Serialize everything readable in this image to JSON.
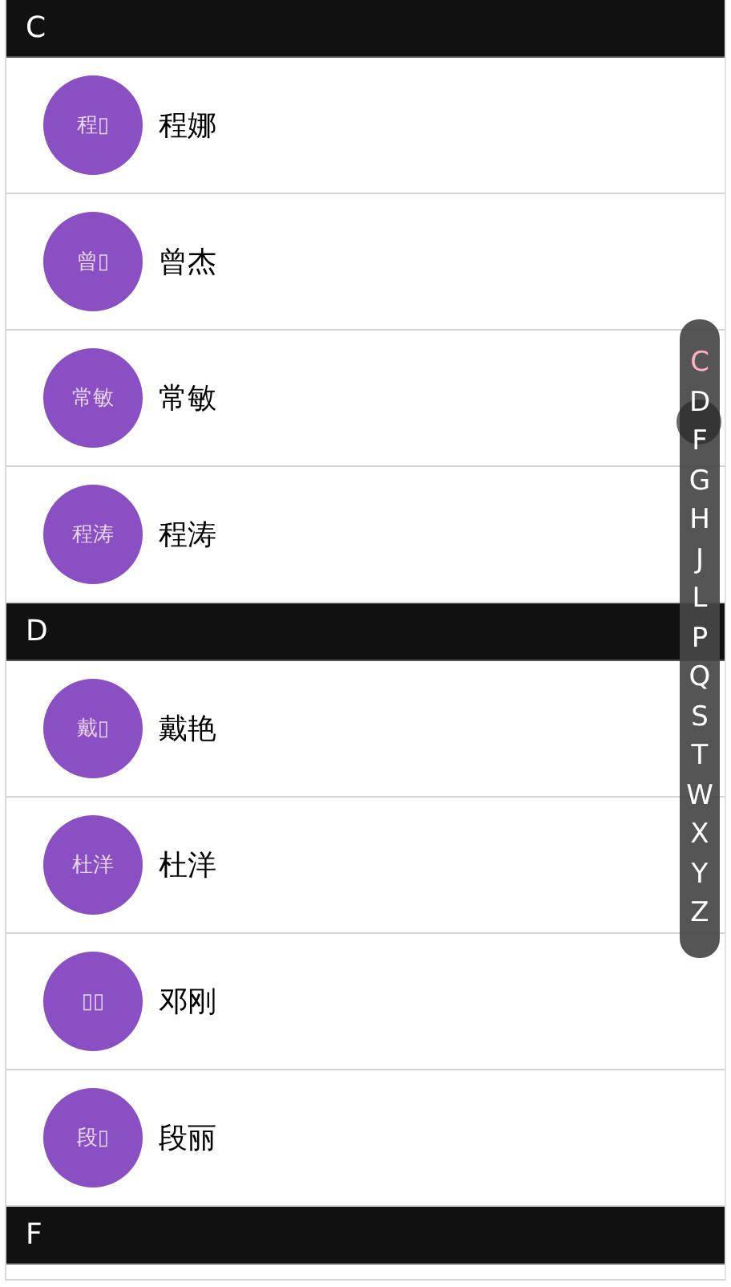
{
  "sections": [
    {
      "letter": "C",
      "contacts": [
        {
          "avatar": "程▯",
          "name": "程娜"
        },
        {
          "avatar": "曾▯",
          "name": "曾杰"
        },
        {
          "avatar": "常敏",
          "name": "常敏"
        },
        {
          "avatar": "程涛",
          "name": "程涛"
        }
      ]
    },
    {
      "letter": "D",
      "contacts": [
        {
          "avatar": "戴▯",
          "name": "戴艳"
        },
        {
          "avatar": "杜洋",
          "name": "杜洋"
        },
        {
          "avatar": "▯▯",
          "name": "邓刚"
        },
        {
          "avatar": "段▯",
          "name": "段丽"
        }
      ]
    },
    {
      "letter": "F"
    }
  ],
  "index_bar": [
    {
      "label": "C",
      "selected": true
    },
    {
      "label": "D",
      "selected": false
    },
    {
      "label": "F",
      "selected": false
    },
    {
      "label": "G",
      "selected": false
    },
    {
      "label": "H",
      "selected": false
    },
    {
      "label": "J",
      "selected": false
    },
    {
      "label": "L",
      "selected": false
    },
    {
      "label": "P",
      "selected": false
    },
    {
      "label": "Q",
      "selected": false
    },
    {
      "label": "S",
      "selected": false
    },
    {
      "label": "T",
      "selected": false
    },
    {
      "label": "W",
      "selected": false
    },
    {
      "label": "X",
      "selected": false
    },
    {
      "label": "Y",
      "selected": false
    },
    {
      "label": "Z",
      "selected": false
    }
  ]
}
